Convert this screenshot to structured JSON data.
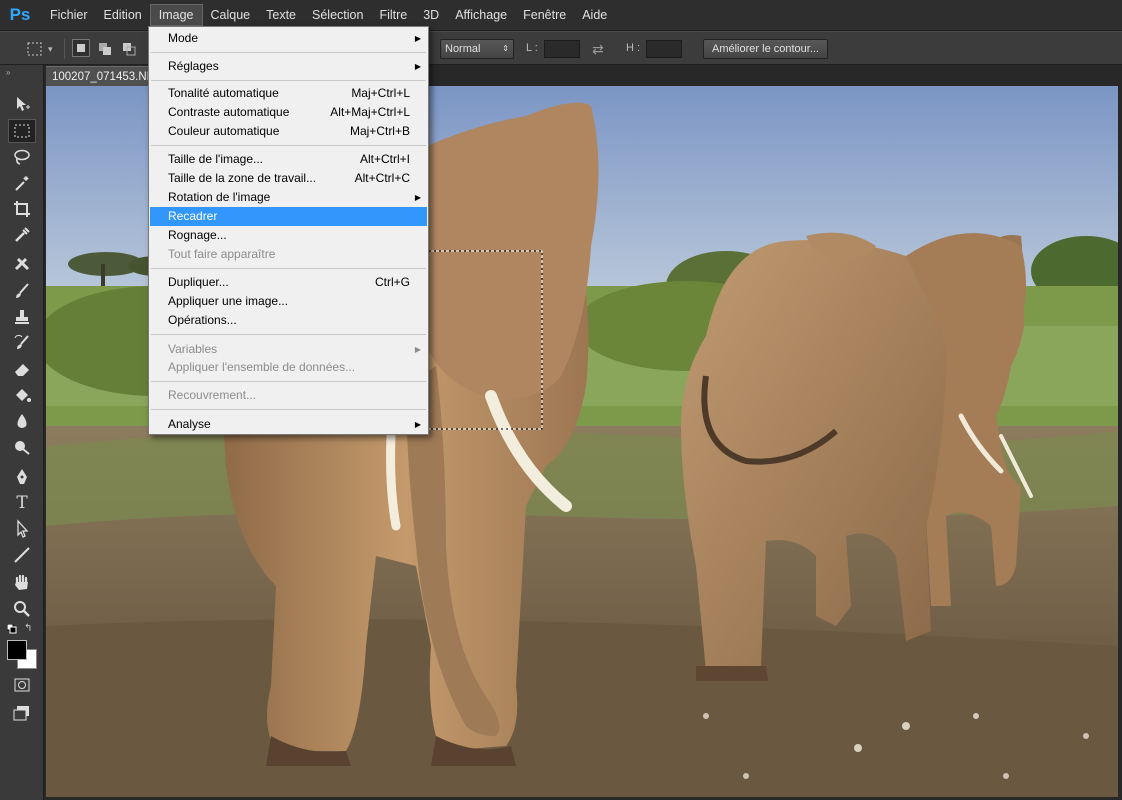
{
  "app": {
    "logo": "Ps"
  },
  "menubar": {
    "items": [
      "Fichier",
      "Edition",
      "Image",
      "Calque",
      "Texte",
      "Sélection",
      "Filtre",
      "3D",
      "Affichage",
      "Fenêtre",
      "Aide"
    ],
    "active": "Image"
  },
  "options": {
    "style_value": "Normal",
    "width_label": "L :",
    "height_label": "H :",
    "refine_button": "Améliorer le contour..."
  },
  "document": {
    "tab_title": "100207_071453.NEF"
  },
  "image_menu": {
    "mode": "Mode",
    "reglages": "Réglages",
    "tonalite": {
      "label": "Tonalité automatique",
      "shortcut": "Maj+Ctrl+L"
    },
    "contraste": {
      "label": "Contraste automatique",
      "shortcut": "Alt+Maj+Ctrl+L"
    },
    "couleur": {
      "label": "Couleur automatique",
      "shortcut": "Maj+Ctrl+B"
    },
    "taille_image": {
      "label": "Taille de l'image...",
      "shortcut": "Alt+Ctrl+I"
    },
    "taille_zone": {
      "label": "Taille de la zone de travail...",
      "shortcut": "Alt+Ctrl+C"
    },
    "rotation": "Rotation de l'image",
    "recadrer": "Recadrer",
    "rognage": "Rognage...",
    "tout_faire": "Tout faire apparaître",
    "dupliquer": {
      "label": "Dupliquer...",
      "shortcut": "Ctrl+G"
    },
    "appliquer_image": "Appliquer une image...",
    "operations": "Opérations...",
    "variables": "Variables",
    "appliquer_donnees": "Appliquer l'ensemble de données...",
    "recouvrement": "Recouvrement...",
    "analyse": "Analyse"
  },
  "colors": {
    "highlight": "#3297fd",
    "menu_bg": "#f0f0f0",
    "ps_blue": "#31a8ff"
  }
}
